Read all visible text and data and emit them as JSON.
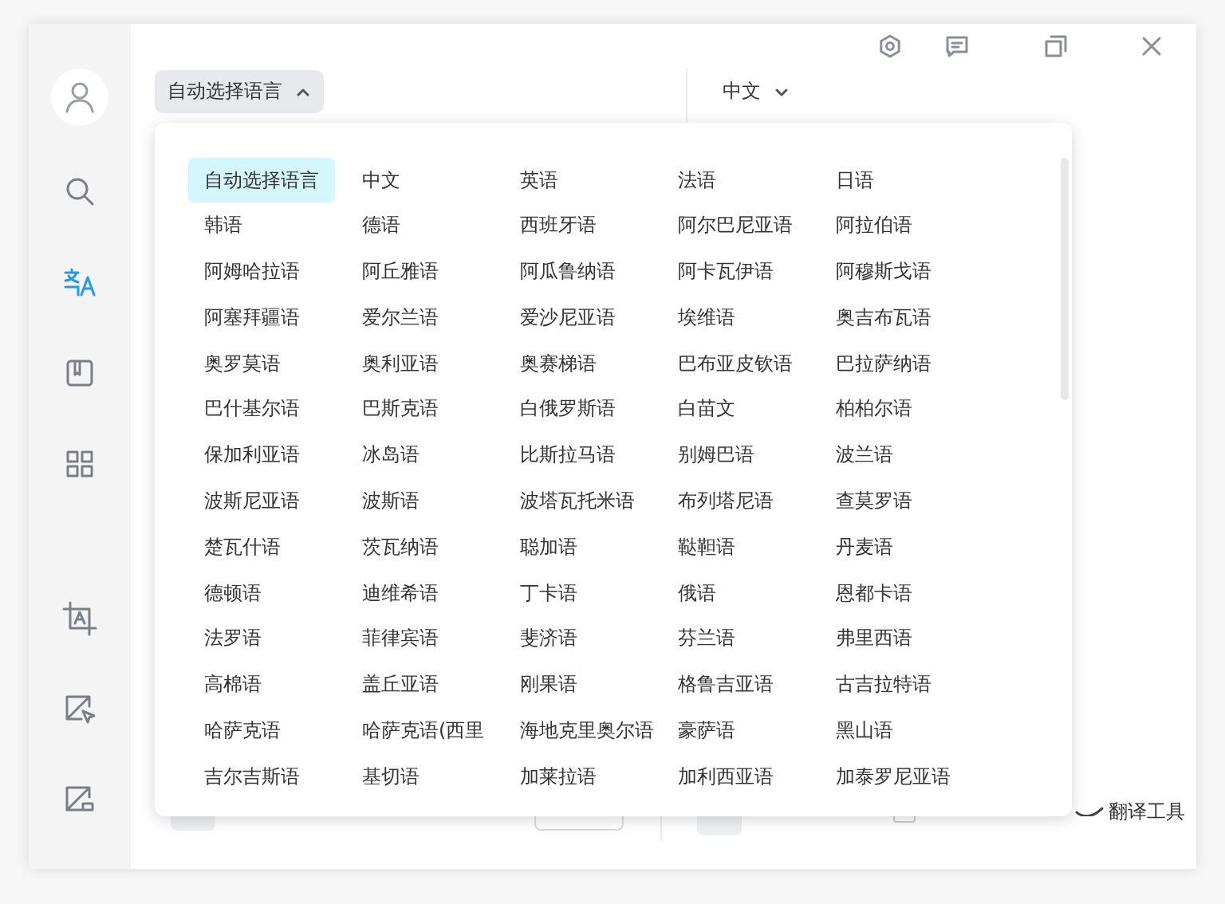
{
  "sidebar": {
    "items": [
      {
        "kind": "avatar",
        "selected": false
      },
      {
        "kind": "search",
        "selected": false
      },
      {
        "kind": "translate",
        "selected": true
      },
      {
        "kind": "book",
        "selected": false
      },
      {
        "kind": "grid",
        "selected": false
      },
      {
        "kind": "crop-text",
        "selected": false
      },
      {
        "kind": "image-cursor",
        "selected": false
      },
      {
        "kind": "image-slash",
        "selected": false
      }
    ]
  },
  "source_language": {
    "label": "自动选择语言",
    "expanded": true
  },
  "target_language": {
    "label": "中文",
    "expanded": false
  },
  "language_menu": {
    "items": [
      {
        "label": "自动选择语言",
        "selected": true
      },
      {
        "label": "中文",
        "selected": false
      },
      {
        "label": "英语",
        "selected": false
      },
      {
        "label": "法语",
        "selected": false
      },
      {
        "label": "日语",
        "selected": false
      },
      {
        "label": "韩语",
        "selected": false
      },
      {
        "label": "德语",
        "selected": false
      },
      {
        "label": "西班牙语",
        "selected": false
      },
      {
        "label": "阿尔巴尼亚语",
        "selected": false
      },
      {
        "label": "阿拉伯语",
        "selected": false
      },
      {
        "label": "阿姆哈拉语",
        "selected": false
      },
      {
        "label": "阿丘雅语",
        "selected": false
      },
      {
        "label": "阿瓜鲁纳语",
        "selected": false
      },
      {
        "label": "阿卡瓦伊语",
        "selected": false
      },
      {
        "label": "阿穆斯戈语",
        "selected": false
      },
      {
        "label": "阿塞拜疆语",
        "selected": false
      },
      {
        "label": "爱尔兰语",
        "selected": false
      },
      {
        "label": "爱沙尼亚语",
        "selected": false
      },
      {
        "label": "埃维语",
        "selected": false
      },
      {
        "label": "奥吉布瓦语",
        "selected": false
      },
      {
        "label": "奥罗莫语",
        "selected": false
      },
      {
        "label": "奥利亚语",
        "selected": false
      },
      {
        "label": "奥赛梯语",
        "selected": false
      },
      {
        "label": "巴布亚皮钦语",
        "selected": false
      },
      {
        "label": "巴拉萨纳语",
        "selected": false
      },
      {
        "label": "巴什基尔语",
        "selected": false
      },
      {
        "label": "巴斯克语",
        "selected": false
      },
      {
        "label": "白俄罗斯语",
        "selected": false
      },
      {
        "label": "白苗文",
        "selected": false
      },
      {
        "label": "柏柏尔语",
        "selected": false
      },
      {
        "label": "保加利亚语",
        "selected": false
      },
      {
        "label": "冰岛语",
        "selected": false
      },
      {
        "label": "比斯拉马语",
        "selected": false
      },
      {
        "label": "别姆巴语",
        "selected": false
      },
      {
        "label": "波兰语",
        "selected": false
      },
      {
        "label": "波斯尼亚语",
        "selected": false
      },
      {
        "label": "波斯语",
        "selected": false
      },
      {
        "label": "波塔瓦托米语",
        "selected": false
      },
      {
        "label": "布列塔尼语",
        "selected": false
      },
      {
        "label": "查莫罗语",
        "selected": false
      },
      {
        "label": "楚瓦什语",
        "selected": false
      },
      {
        "label": "茨瓦纳语",
        "selected": false
      },
      {
        "label": "聪加语",
        "selected": false
      },
      {
        "label": "鞑靼语",
        "selected": false
      },
      {
        "label": "丹麦语",
        "selected": false
      },
      {
        "label": "德顿语",
        "selected": false
      },
      {
        "label": "迪维希语",
        "selected": false
      },
      {
        "label": "丁卡语",
        "selected": false
      },
      {
        "label": "俄语",
        "selected": false
      },
      {
        "label": "恩都卡语",
        "selected": false
      },
      {
        "label": "法罗语",
        "selected": false
      },
      {
        "label": "菲律宾语",
        "selected": false
      },
      {
        "label": "斐济语",
        "selected": false
      },
      {
        "label": "芬兰语",
        "selected": false
      },
      {
        "label": "弗里西语",
        "selected": false
      },
      {
        "label": "高棉语",
        "selected": false
      },
      {
        "label": "盖丘亚语",
        "selected": false
      },
      {
        "label": "刚果语",
        "selected": false
      },
      {
        "label": "格鲁吉亚语",
        "selected": false
      },
      {
        "label": "古吉拉特语",
        "selected": false
      },
      {
        "label": "哈萨克语",
        "selected": false
      },
      {
        "label": "哈萨克语(西里",
        "selected": false
      },
      {
        "label": "海地克里奥尔语",
        "selected": false
      },
      {
        "label": "豪萨语",
        "selected": false
      },
      {
        "label": "黑山语",
        "selected": false
      },
      {
        "label": "吉尔吉斯语",
        "selected": false
      },
      {
        "label": "基切语",
        "selected": false
      },
      {
        "label": "加莱拉语",
        "selected": false
      },
      {
        "label": "加利西亚语",
        "selected": false
      },
      {
        "label": "加泰罗尼亚语",
        "selected": false
      }
    ]
  },
  "footer": {
    "checkbox": {
      "checked": false
    },
    "tool_link": "翻译工具"
  }
}
